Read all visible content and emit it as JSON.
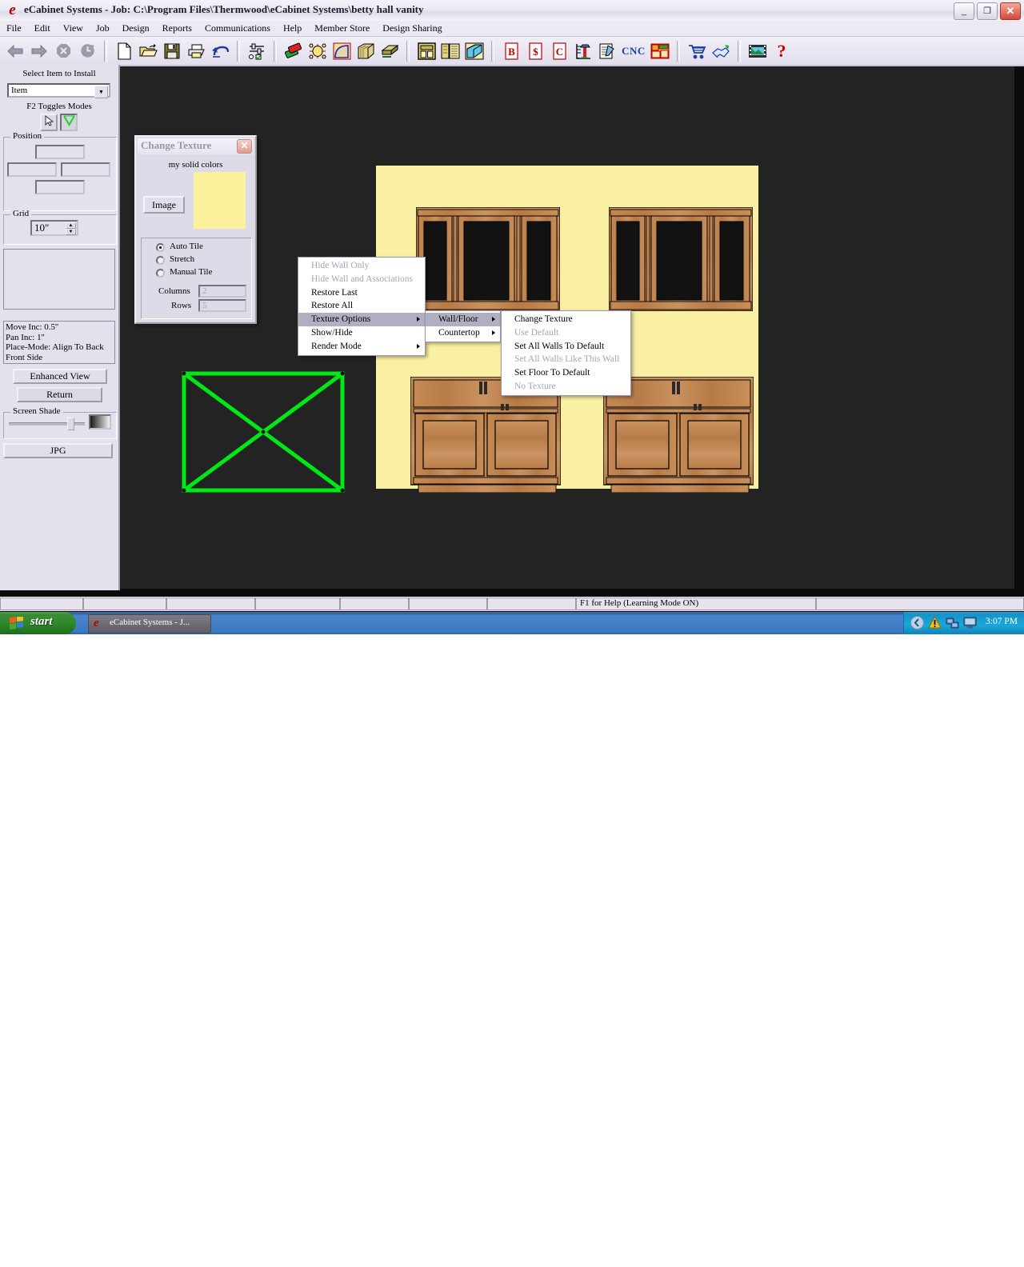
{
  "window": {
    "title": "eCabinet Systems - Job: C:\\Program Files\\Thermwood\\eCabinet Systems\\betty hall vanity",
    "app_icon": "ecabinet-logo-icon",
    "minimize": "_",
    "maximize": "❐",
    "close": "✕"
  },
  "menubar": {
    "items": [
      {
        "label": "File"
      },
      {
        "label": "Edit"
      },
      {
        "label": "View"
      },
      {
        "label": "Job"
      },
      {
        "label": "Design"
      },
      {
        "label": "Reports"
      },
      {
        "label": "Communications"
      },
      {
        "label": "Help"
      },
      {
        "label": "Member Store"
      },
      {
        "label": "Design Sharing"
      }
    ]
  },
  "toolbar": {
    "groups": [
      [
        "back-arrow-icon",
        "forward-arrow-icon",
        "stop-icon",
        "refresh-icon"
      ],
      [
        "new-file-icon",
        "open-folder-icon",
        "save-disk-icon",
        "print-icon",
        "undo-icon"
      ],
      [
        "options-sliders-icon"
      ],
      [
        "paint-tubes-icon",
        "hardware-icon",
        "molding-icon",
        "crown-profile-icon",
        "countertop-icon"
      ],
      [
        "cabinet-icon",
        "cabinet-library-icon",
        "flooring-icon"
      ],
      [
        "bid-report-icon",
        "pricing-report-icon",
        "cutlist-report-icon",
        "elevation-icon",
        "notes-icon",
        "cnc-icon",
        "nesting-icon"
      ],
      [
        "shopping-cart-icon",
        "handshake-icon"
      ],
      [
        "film-strip-icon",
        "help-question-icon"
      ]
    ],
    "cnc_label": "CNC"
  },
  "sidebar": {
    "select_item_label": "Select Item to Install",
    "item_combo_value": "Item",
    "f2_label": "F2 Toggles Modes",
    "mode_buttons": [
      {
        "name": "pointer-mode-button",
        "icon": "cursor-arrow-icon"
      },
      {
        "name": "wireframe-mode-button",
        "icon": "green-vee-icon"
      }
    ],
    "position_group": "Position",
    "position_fields": [
      "",
      "",
      "",
      ""
    ],
    "grid_group": "Grid",
    "grid_value": "10\"",
    "info_lines": [
      "Move Inc: 0.5''",
      "Pan Inc: 1''",
      "Place-Mode: Align To Back",
      "Front Side"
    ],
    "enhanced_view_button": "Enhanced View",
    "return_button": "Return",
    "screen_shade_group": "Screen Shade",
    "jpg_button": "JPG"
  },
  "dialog": {
    "title": "Change Texture",
    "close": "✕",
    "caption": "my solid colors",
    "image_button": "Image",
    "swatch_color": "#fbf09c",
    "tile_options": [
      {
        "label": "Auto Tile",
        "selected": true
      },
      {
        "label": "Stretch",
        "selected": false
      },
      {
        "label": "Manual Tile",
        "selected": false
      }
    ],
    "columns_label": "Columns",
    "columns_value": "2",
    "rows_label": "Rows",
    "rows_value": "5"
  },
  "context_menu": {
    "items": [
      {
        "label": "Hide Wall Only",
        "enabled": false,
        "submenu": false,
        "highlighted": false
      },
      {
        "label": "Hide Wall and Associations",
        "enabled": false,
        "submenu": false,
        "highlighted": false
      },
      {
        "label": "Restore Last",
        "enabled": true,
        "submenu": false,
        "highlighted": false
      },
      {
        "label": "Restore All",
        "enabled": true,
        "submenu": false,
        "highlighted": false
      },
      {
        "label": "Texture Options",
        "enabled": true,
        "submenu": true,
        "highlighted": true
      },
      {
        "label": "Show/Hide",
        "enabled": true,
        "submenu": false,
        "highlighted": false
      },
      {
        "label": "Render Mode",
        "enabled": true,
        "submenu": true,
        "highlighted": false
      }
    ]
  },
  "submenu_1": {
    "items": [
      {
        "label": "Wall/Floor",
        "enabled": true,
        "submenu": true,
        "highlighted": true
      },
      {
        "label": "Countertop",
        "enabled": true,
        "submenu": true,
        "highlighted": false
      }
    ]
  },
  "submenu_2": {
    "items": [
      {
        "label": "Change Texture",
        "enabled": true,
        "submenu": false,
        "highlighted": false
      },
      {
        "label": "Use Default",
        "enabled": false,
        "submenu": false,
        "highlighted": false
      },
      {
        "label": "Set All Walls To Default",
        "enabled": true,
        "submenu": false,
        "highlighted": false
      },
      {
        "label": "Set All Walls Like This Wall",
        "enabled": false,
        "submenu": false,
        "highlighted": false
      },
      {
        "label": "Set Floor To Default",
        "enabled": true,
        "submenu": false,
        "highlighted": false
      },
      {
        "label": "No Texture",
        "enabled": false,
        "submenu": false,
        "highlighted": false
      }
    ]
  },
  "statusbar": {
    "help_text": "F1 for Help (Learning Mode ON)",
    "panels": [
      "",
      "",
      "",
      "",
      "",
      "",
      "",
      "F1 for Help (Learning Mode ON)",
      ""
    ]
  },
  "taskbar": {
    "start_label": "start",
    "task_label": "eCabinet Systems - J...",
    "task_icon": "ecabinet-logo-icon",
    "tray_icons": [
      "chevron-left-icon",
      "warning-shield-icon",
      "network-icon",
      "display-icon"
    ],
    "clock": "3:07 PM"
  },
  "colors": {
    "wall": "#f9f0a4",
    "canvas_bg": "#232323",
    "selection": "#00e816",
    "wood": "#c08552",
    "panel_bg": "#e4e1ec"
  }
}
